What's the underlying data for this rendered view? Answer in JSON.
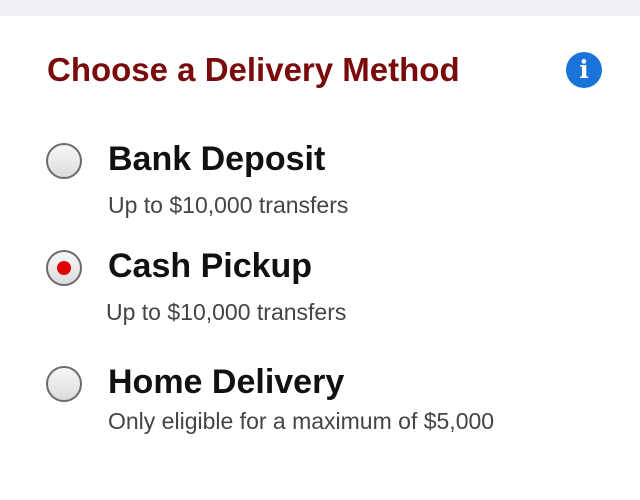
{
  "title": "Choose a Delivery Method",
  "info_icon": "info-icon",
  "accent_color": "#7a0b0b",
  "selected_radio_color": "#e10000",
  "options": [
    {
      "label": "Bank Deposit",
      "description": "Up to $10,000 transfers",
      "selected": false
    },
    {
      "label": "Cash Pickup",
      "description": "Up to $10,000 transfers",
      "selected": true
    },
    {
      "label": "Home Delivery",
      "description": "Only eligible for a maximum of $5,000",
      "selected": false
    }
  ]
}
